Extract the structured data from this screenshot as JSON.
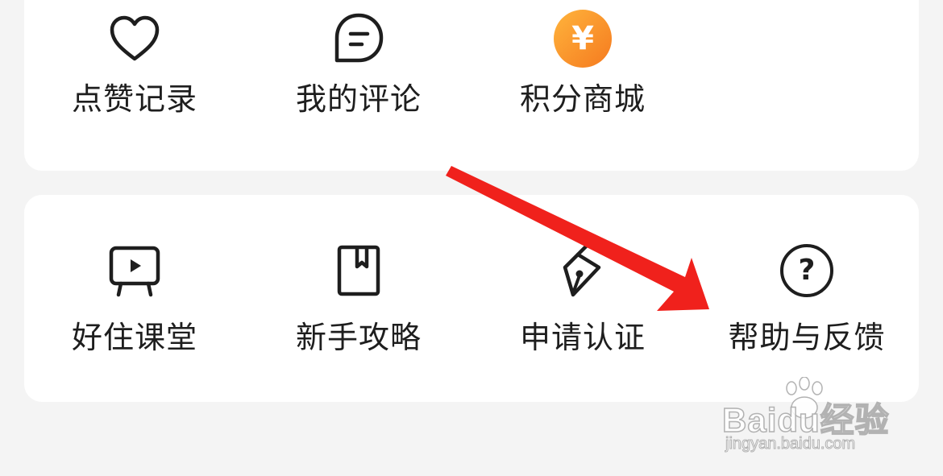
{
  "menu_top": [
    {
      "label": "点赞记录",
      "icon": "heart-icon"
    },
    {
      "label": "我的评论",
      "icon": "comment-icon"
    },
    {
      "label": "积分商城",
      "icon": "yen-coin-icon",
      "icon_symbol": "¥"
    }
  ],
  "menu_bottom": [
    {
      "label": "好住课堂",
      "icon": "video-board-icon"
    },
    {
      "label": "新手攻略",
      "icon": "bookmark-book-icon"
    },
    {
      "label": "申请认证",
      "icon": "pen-nib-icon"
    },
    {
      "label": "帮助与反馈",
      "icon": "help-question-icon",
      "icon_symbol": "?"
    }
  ],
  "watermark": {
    "logo": "Baidu经验",
    "url": "jingyan.baidu.com"
  },
  "colors": {
    "background": "#f4f4f4",
    "card": "#ffffff",
    "text": "#1e1e1e",
    "coin_gradient_start": "#ffb43c",
    "coin_gradient_end": "#f57a1f",
    "annotation_arrow": "#f0211c"
  }
}
